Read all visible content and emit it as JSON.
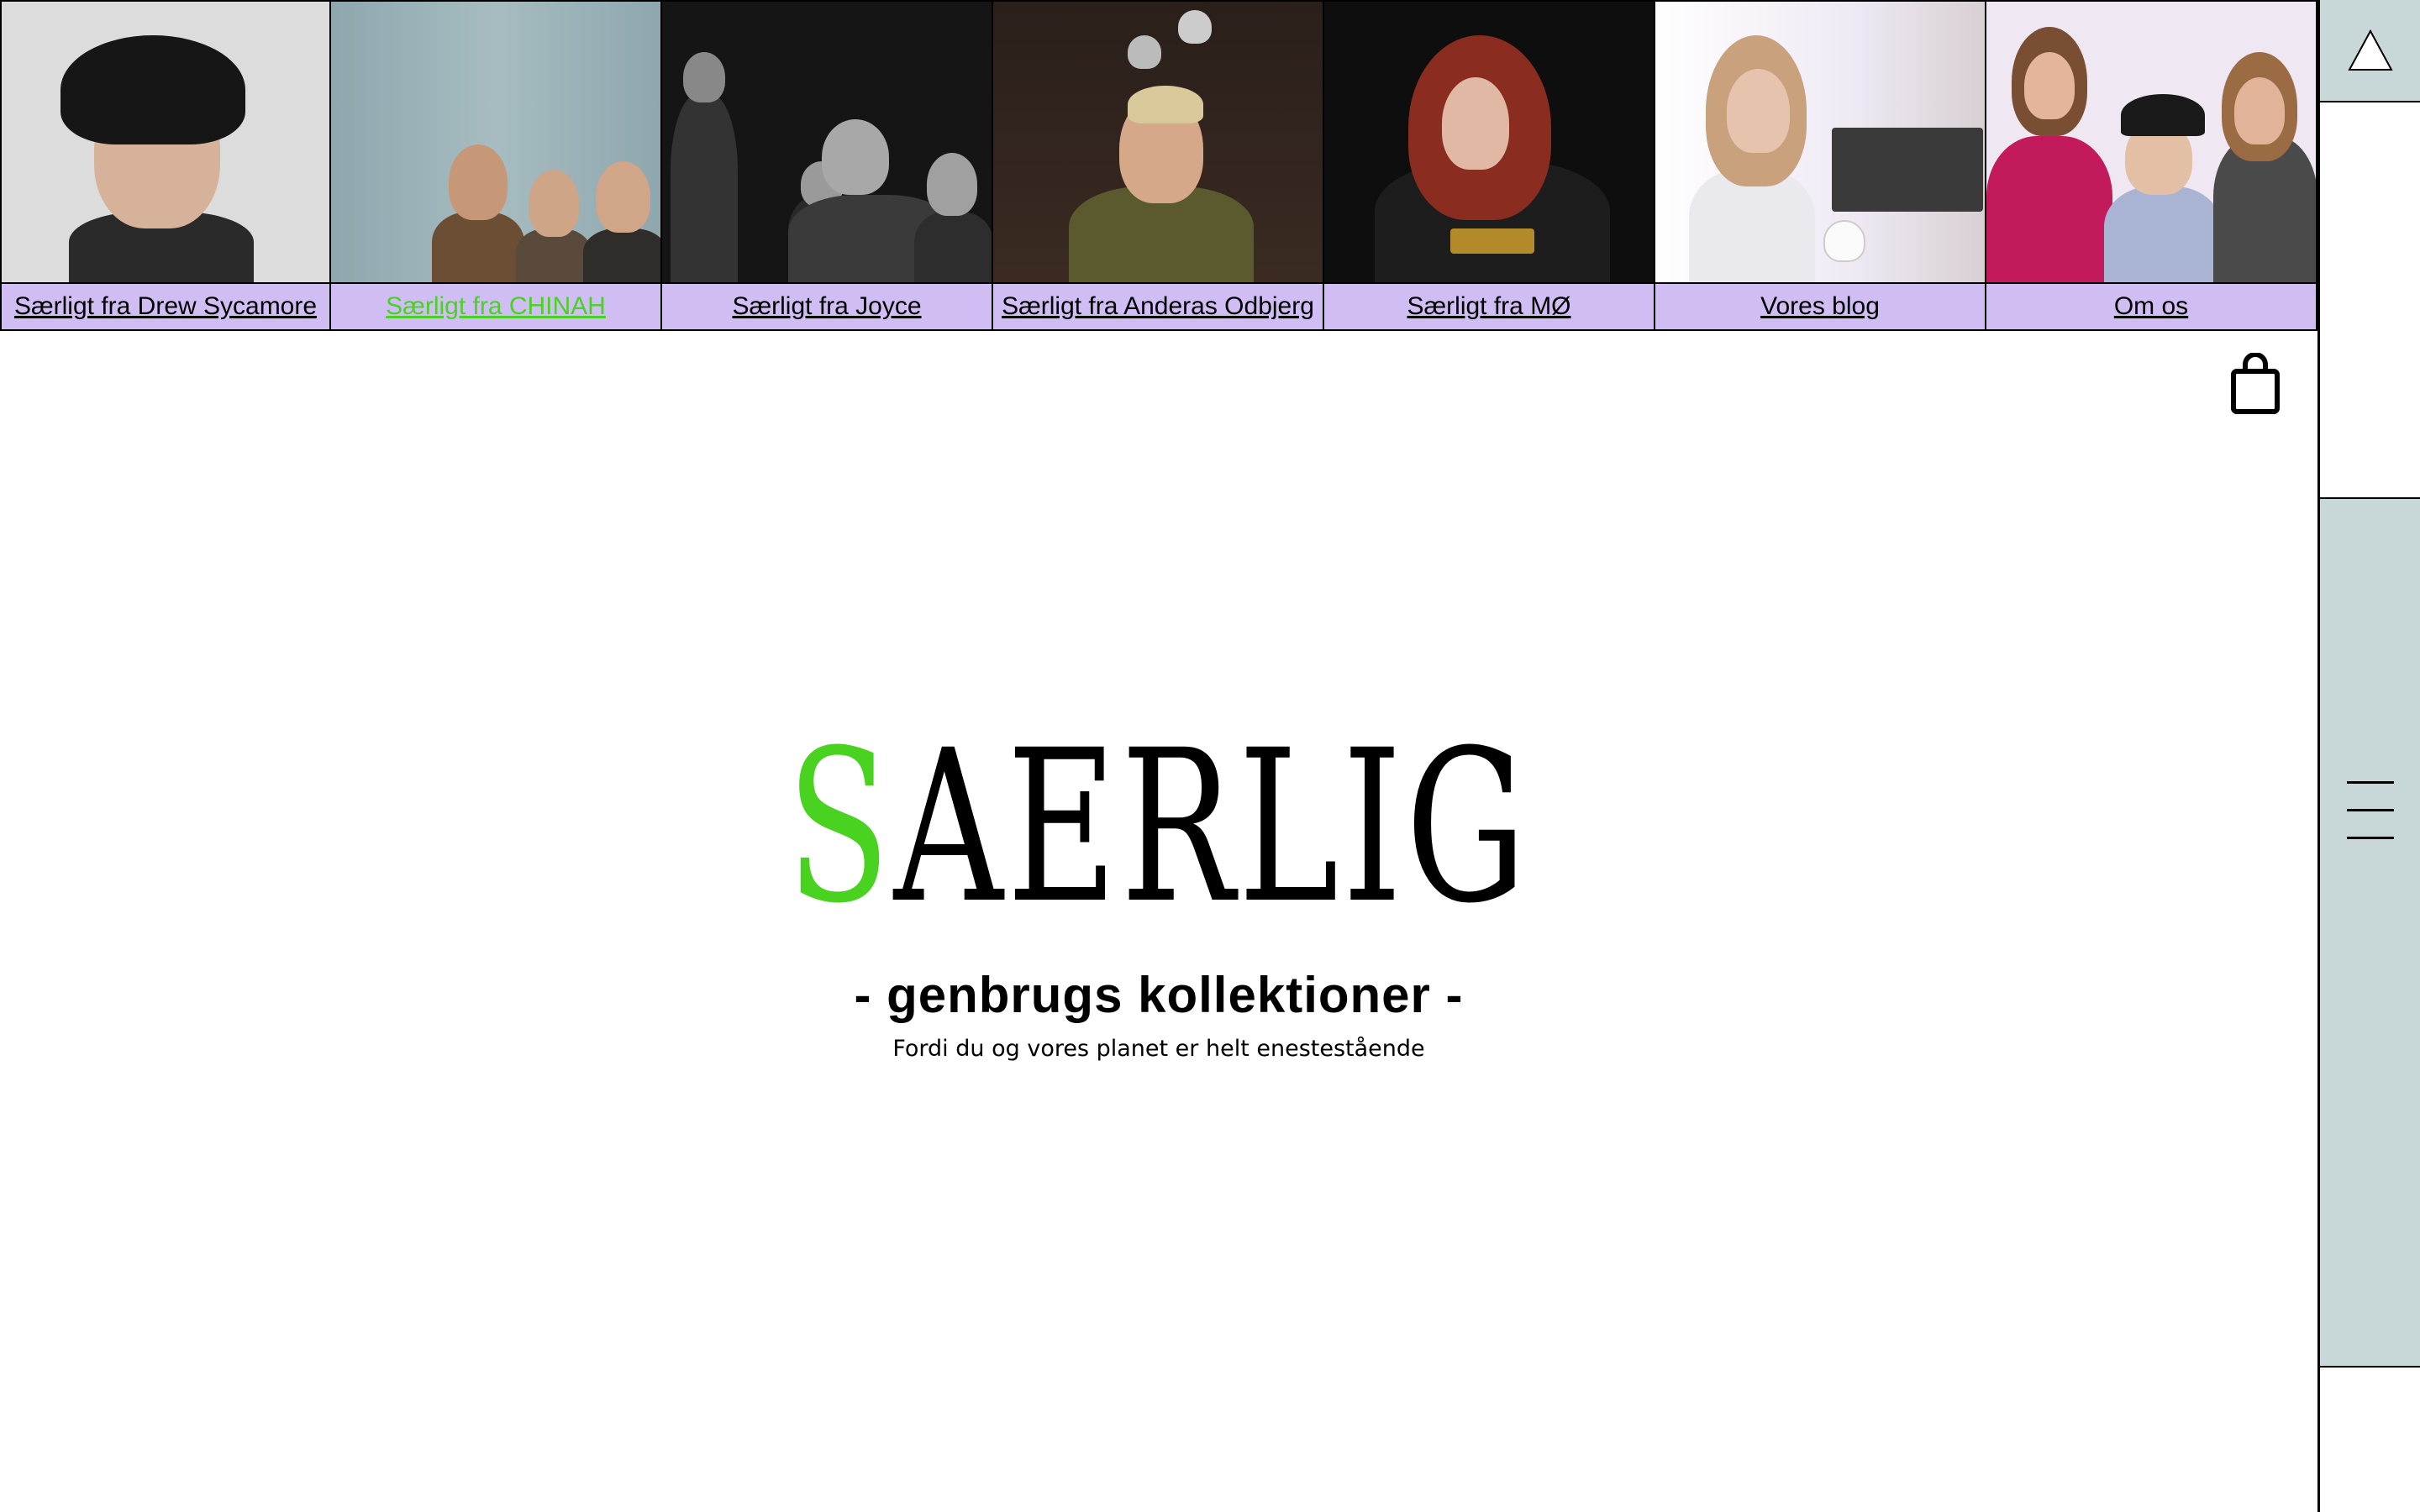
{
  "nav": {
    "tiles": [
      {
        "label": "Særligt fra Drew Sycamore",
        "active": false
      },
      {
        "label": "Særligt fra CHINAH",
        "active": true
      },
      {
        "label": "Særligt fra Joyce",
        "active": false
      },
      {
        "label": "Særligt fra Anderas Odbjerg",
        "active": false
      },
      {
        "label": "Særligt fra MØ",
        "active": false
      },
      {
        "label": "Vores blog",
        "active": false
      },
      {
        "label": "Om os",
        "active": false
      }
    ]
  },
  "rail": {
    "scroll_top_icon": "triangle-up-icon",
    "menu_icon": "hamburger-menu-icon"
  },
  "cart": {
    "icon": "shopping-bag-icon"
  },
  "hero": {
    "logo_first": "S",
    "logo_rest": "AERLIG",
    "tagline": "- genbrugs kollektioner -",
    "subtitle": "Fordi du og vores planet er helt enestestående"
  },
  "colors": {
    "accent_green": "#49d21f",
    "label_purple": "#d0bdf4",
    "rail_blue_grey": "#c8d8d8"
  }
}
